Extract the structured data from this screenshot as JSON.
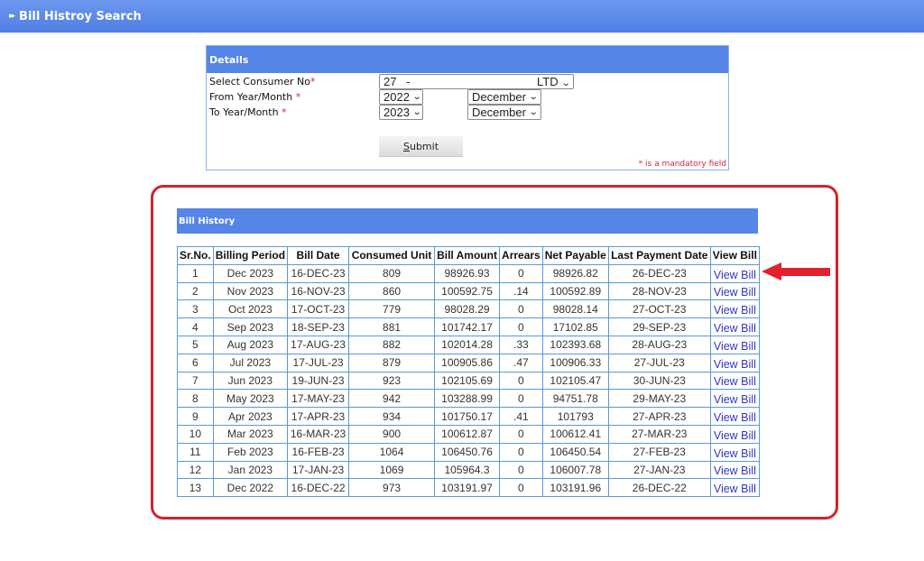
{
  "header": {
    "title": "Bill Histroy Search",
    "bullet_icon": "double-chevron-right"
  },
  "details": {
    "title": "Details",
    "fields": [
      {
        "label": "Select Consumer No",
        "required": "*",
        "value_left": "27",
        "value_mid": "-",
        "value_right": "LTD"
      },
      {
        "label": "From Year/Month ",
        "required": "*",
        "year": "2022",
        "month": "December"
      },
      {
        "label": "To Year/Month ",
        "required": "*",
        "year": "2023",
        "month": "December"
      }
    ],
    "submit_label_u": "S",
    "submit_label_rest": "ubmit",
    "mandatory_note": "* is a mandatory field"
  },
  "history": {
    "title": "Bill History",
    "columns": [
      "Sr.No.",
      "Billing Period",
      "Bill Date",
      "Consumed Unit",
      "Bill Amount",
      "Arrears",
      "Net Payable",
      "Last Payment Date",
      "View Bill"
    ],
    "rows": [
      [
        "1",
        "Dec 2023",
        "16-DEC-23",
        "809",
        "98926.93",
        "0",
        "98926.82",
        "26-DEC-23",
        "View Bill"
      ],
      [
        "2",
        "Nov 2023",
        "16-NOV-23",
        "860",
        "100592.75",
        ".14",
        "100592.89",
        "28-NOV-23",
        "View Bill"
      ],
      [
        "3",
        "Oct 2023",
        "17-OCT-23",
        "779",
        "98028.29",
        "0",
        "98028.14",
        "27-OCT-23",
        "View Bill"
      ],
      [
        "4",
        "Sep 2023",
        "18-SEP-23",
        "881",
        "101742.17",
        "0",
        "17102.85",
        "29-SEP-23",
        "View Bill"
      ],
      [
        "5",
        "Aug 2023",
        "17-AUG-23",
        "882",
        "102014.28",
        ".33",
        "102393.68",
        "28-AUG-23",
        "View Bill"
      ],
      [
        "6",
        "Jul 2023",
        "17-JUL-23",
        "879",
        "100905.86",
        ".47",
        "100906.33",
        "27-JUL-23",
        "View Bill"
      ],
      [
        "7",
        "Jun 2023",
        "19-JUN-23",
        "923",
        "102105.69",
        "0",
        "102105.47",
        "30-JUN-23",
        "View Bill"
      ],
      [
        "8",
        "May 2023",
        "17-MAY-23",
        "942",
        "103288.99",
        "0",
        "94751.78",
        "29-MAY-23",
        "View Bill"
      ],
      [
        "9",
        "Apr 2023",
        "17-APR-23",
        "934",
        "101750.17",
        ".41",
        "101793",
        "27-APR-23",
        "View Bill"
      ],
      [
        "10",
        "Mar 2023",
        "16-MAR-23",
        "900",
        "100612.87",
        "0",
        "100612.41",
        "27-MAR-23",
        "View Bill"
      ],
      [
        "11",
        "Feb 2023",
        "16-FEB-23",
        "1064",
        "106450.76",
        "0",
        "106450.54",
        "27-FEB-23",
        "View Bill"
      ],
      [
        "12",
        "Jan 2023",
        "17-JAN-23",
        "1069",
        "105964.3",
        "0",
        "106007.78",
        "27-JAN-23",
        "View Bill"
      ],
      [
        "13",
        "Dec 2022",
        "16-DEC-22",
        "973",
        "103191.97",
        "0",
        "103191.96",
        "26-DEC-22",
        "View Bill"
      ]
    ]
  },
  "annotation": {
    "frame_color": "#d5202f",
    "arrow_color": "#e3202c",
    "arrow_icon": "arrow-left"
  },
  "colors": {
    "header_blue": "#5585e6",
    "link": "#3434c0",
    "required": "#d8263e",
    "table_border": "#5a98d8"
  }
}
